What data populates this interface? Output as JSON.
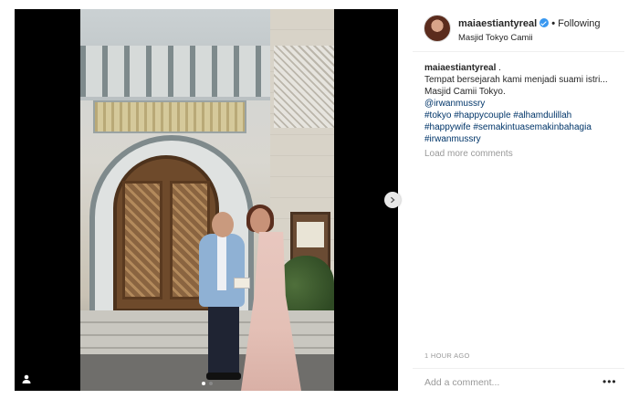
{
  "post": {
    "username": "maiaestiantyreal",
    "separator": "•",
    "follow_status": "Following",
    "location": "Masjid Tokyo Camii"
  },
  "caption": {
    "username": "maiaestiantyreal",
    "text_after_username": ".",
    "line1": "Tempat bersejarah kami menjadi suami istri...",
    "line2": "Masjid Camii Tokyo.",
    "mention": "@irwanmussry",
    "hashtags_line1": "#tokyo #happycouple #alhamdulillah",
    "hashtags_line2": "#happywife #semakintuasemakinbahagia",
    "hashtags_line3": "#irwanmussry"
  },
  "load_more": "Load more comments",
  "timestamp": "1 HOUR AGO",
  "comment_input": {
    "placeholder": "Add a comment..."
  },
  "more_options": "•••",
  "icons": [
    "verified-badge-icon",
    "next-arrow-icon",
    "user-tag-icon",
    "more-options-icon"
  ],
  "colors": {
    "link": "#003569",
    "verified": "#3897f0",
    "muted": "#999999"
  }
}
